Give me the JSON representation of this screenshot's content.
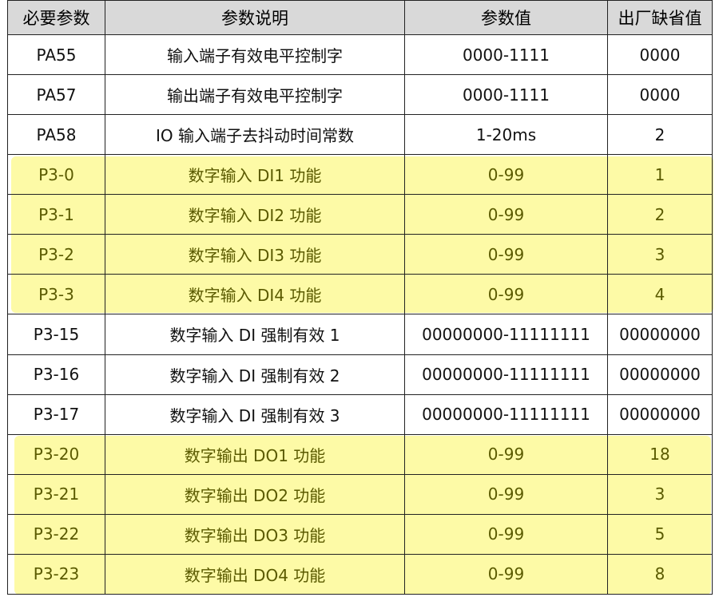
{
  "table": {
    "headers": [
      "必要参数",
      "参数说明",
      "参数值",
      "出厂缺省值"
    ],
    "rows": [
      [
        "PA55",
        "输入端子有效电平控制字",
        "0000-1111",
        "0000"
      ],
      [
        "PA57",
        "输出端子有效电平控制字",
        "0000-1111",
        "0000"
      ],
      [
        "PA58",
        "IO 输入端子去抖动时间常数",
        "1-20ms",
        "2"
      ],
      [
        "P3-0",
        "数字输入 DI1 功能",
        "0-99",
        "1"
      ],
      [
        "P3-1",
        "数字输入 DI2 功能",
        "0-99",
        "2"
      ],
      [
        "P3-2",
        "数字输入 DI3 功能",
        "0-99",
        "3"
      ],
      [
        "P3-3",
        "数字输入 DI4 功能",
        "0-99",
        "4"
      ],
      [
        "P3-15",
        "数字输入 DI 强制有效 1",
        "00000000-11111111",
        "00000000"
      ],
      [
        "P3-16",
        "数字输入 DI 强制有效 2",
        "00000000-11111111",
        "00000000"
      ],
      [
        "P3-17",
        "数字输入 DI 强制有效 3",
        "00000000-11111111",
        "00000000"
      ],
      [
        "P3-20",
        "数字输出 DO1 功能",
        "0-99",
        "18"
      ],
      [
        "P3-21",
        "数字输出 DO2 功能",
        "0-99",
        "3"
      ],
      [
        "P3-22",
        "数字输出 DO3 功能",
        "0-99",
        "5"
      ],
      [
        "P3-23",
        "数字输出 DO4 功能",
        "0-99",
        "8"
      ]
    ]
  },
  "colors": {
    "highlight": "#fdfaa6",
    "header_bg": "#d9d9d9",
    "border": "#222222"
  }
}
